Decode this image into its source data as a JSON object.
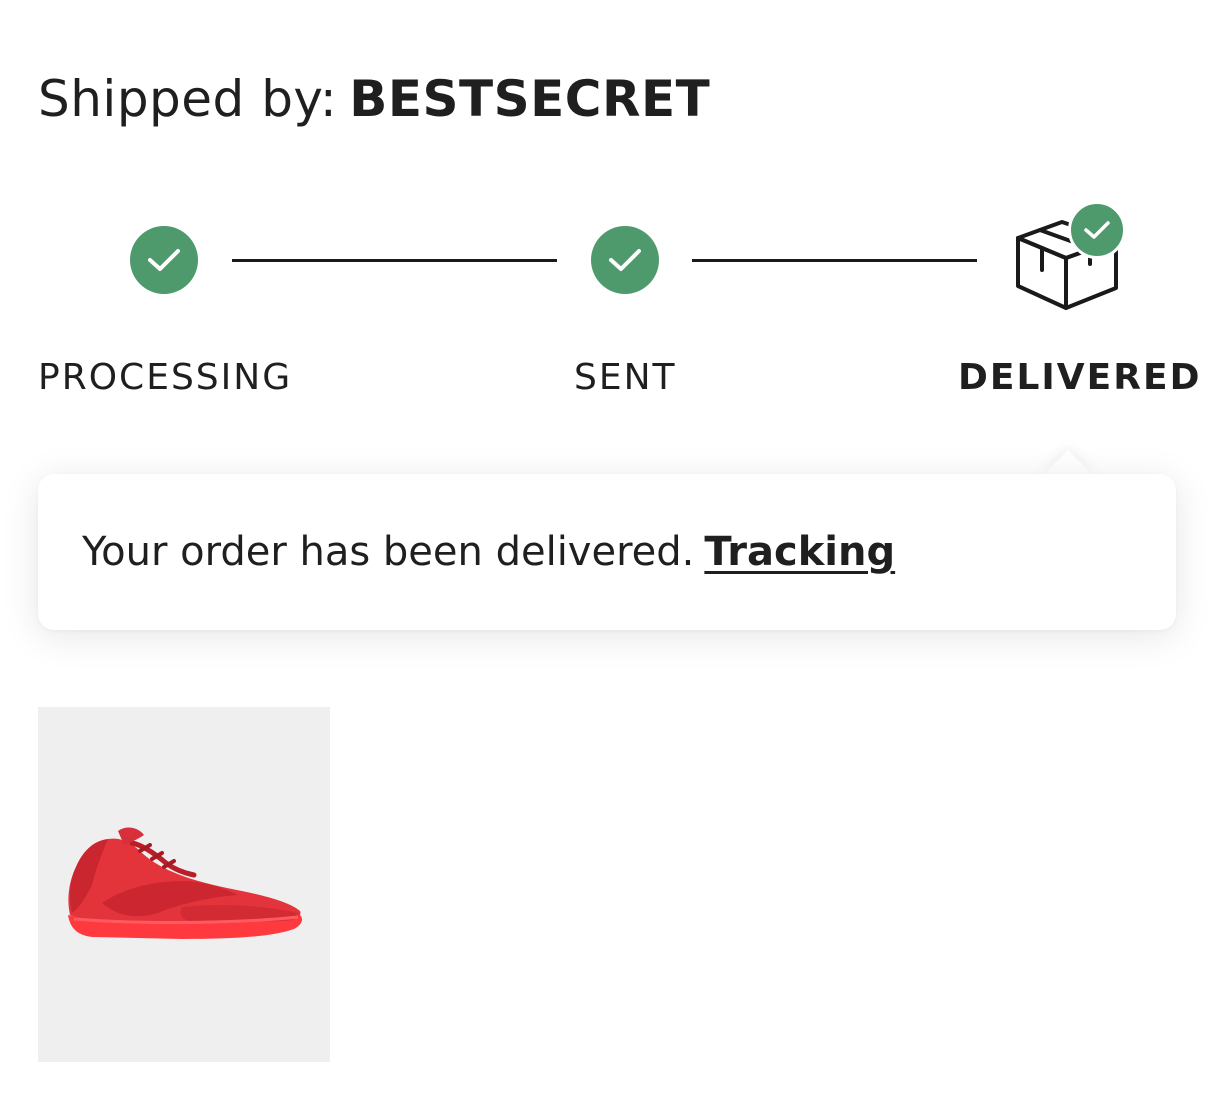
{
  "header": {
    "shipped_by_label": "Shipped by:",
    "carrier": "BESTSECRET"
  },
  "tracker": {
    "steps": [
      {
        "label": "PROCESSING",
        "state": "complete",
        "icon": "check-icon"
      },
      {
        "label": "SENT",
        "state": "complete",
        "icon": "check-icon"
      },
      {
        "label": "DELIVERED",
        "state": "current-complete",
        "icon": "package-box-icon"
      }
    ]
  },
  "status_card": {
    "message": "Your order has been delivered.",
    "link_label": "Tracking"
  },
  "product": {
    "image_icon": "red-sneaker-image"
  },
  "colors": {
    "success_green": "#4e9a6c",
    "text": "#1f1f1f",
    "thumb_background": "#efefef",
    "sneaker_red": "#e8323e"
  }
}
